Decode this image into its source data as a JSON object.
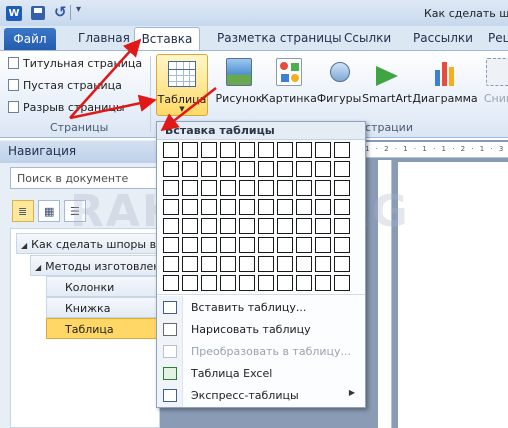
{
  "window": {
    "title": "Как сделать шп",
    "app_icon_letter": "W"
  },
  "tabs": {
    "file": "Файл",
    "home": "Главная",
    "insert": "Вставка",
    "layout": "Разметка страницы",
    "references": "Ссылки",
    "mailings": "Рассылки",
    "review": "Рец"
  },
  "ribbon": {
    "pages_group": {
      "cover": "Титульная страница",
      "blank": "Пустая страница",
      "break": "Разрыв страницы",
      "label": "Страницы"
    },
    "table_button": "Таблица",
    "picture": "Рисунок",
    "clipart": "Картинка",
    "shapes": "Фигуры",
    "smartart": "SmartArt",
    "chart": "Диаграмма",
    "screenshot": "Сним",
    "illustrations_label": "страции"
  },
  "nav": {
    "title": "Навигация",
    "search_placeholder": "Поиск в документе",
    "items": [
      "Как сделать шпоры в во",
      "Методы изготовлен",
      "Колонки",
      "Книжка",
      "Таблица"
    ]
  },
  "menu": {
    "header": "Вставка таблицы",
    "grid_cols": 10,
    "grid_rows": 8,
    "items": [
      "Вставить таблицу...",
      "Нарисовать таблицу",
      "Преобразовать в таблицу...",
      "Таблица Excel",
      "Экспресс-таблицы"
    ]
  },
  "watermark": "RAK-M...ORG",
  "colors": {
    "accent_red": "#e01818",
    "highlight": "#ffd766",
    "file_tab": "#2f69bd"
  }
}
